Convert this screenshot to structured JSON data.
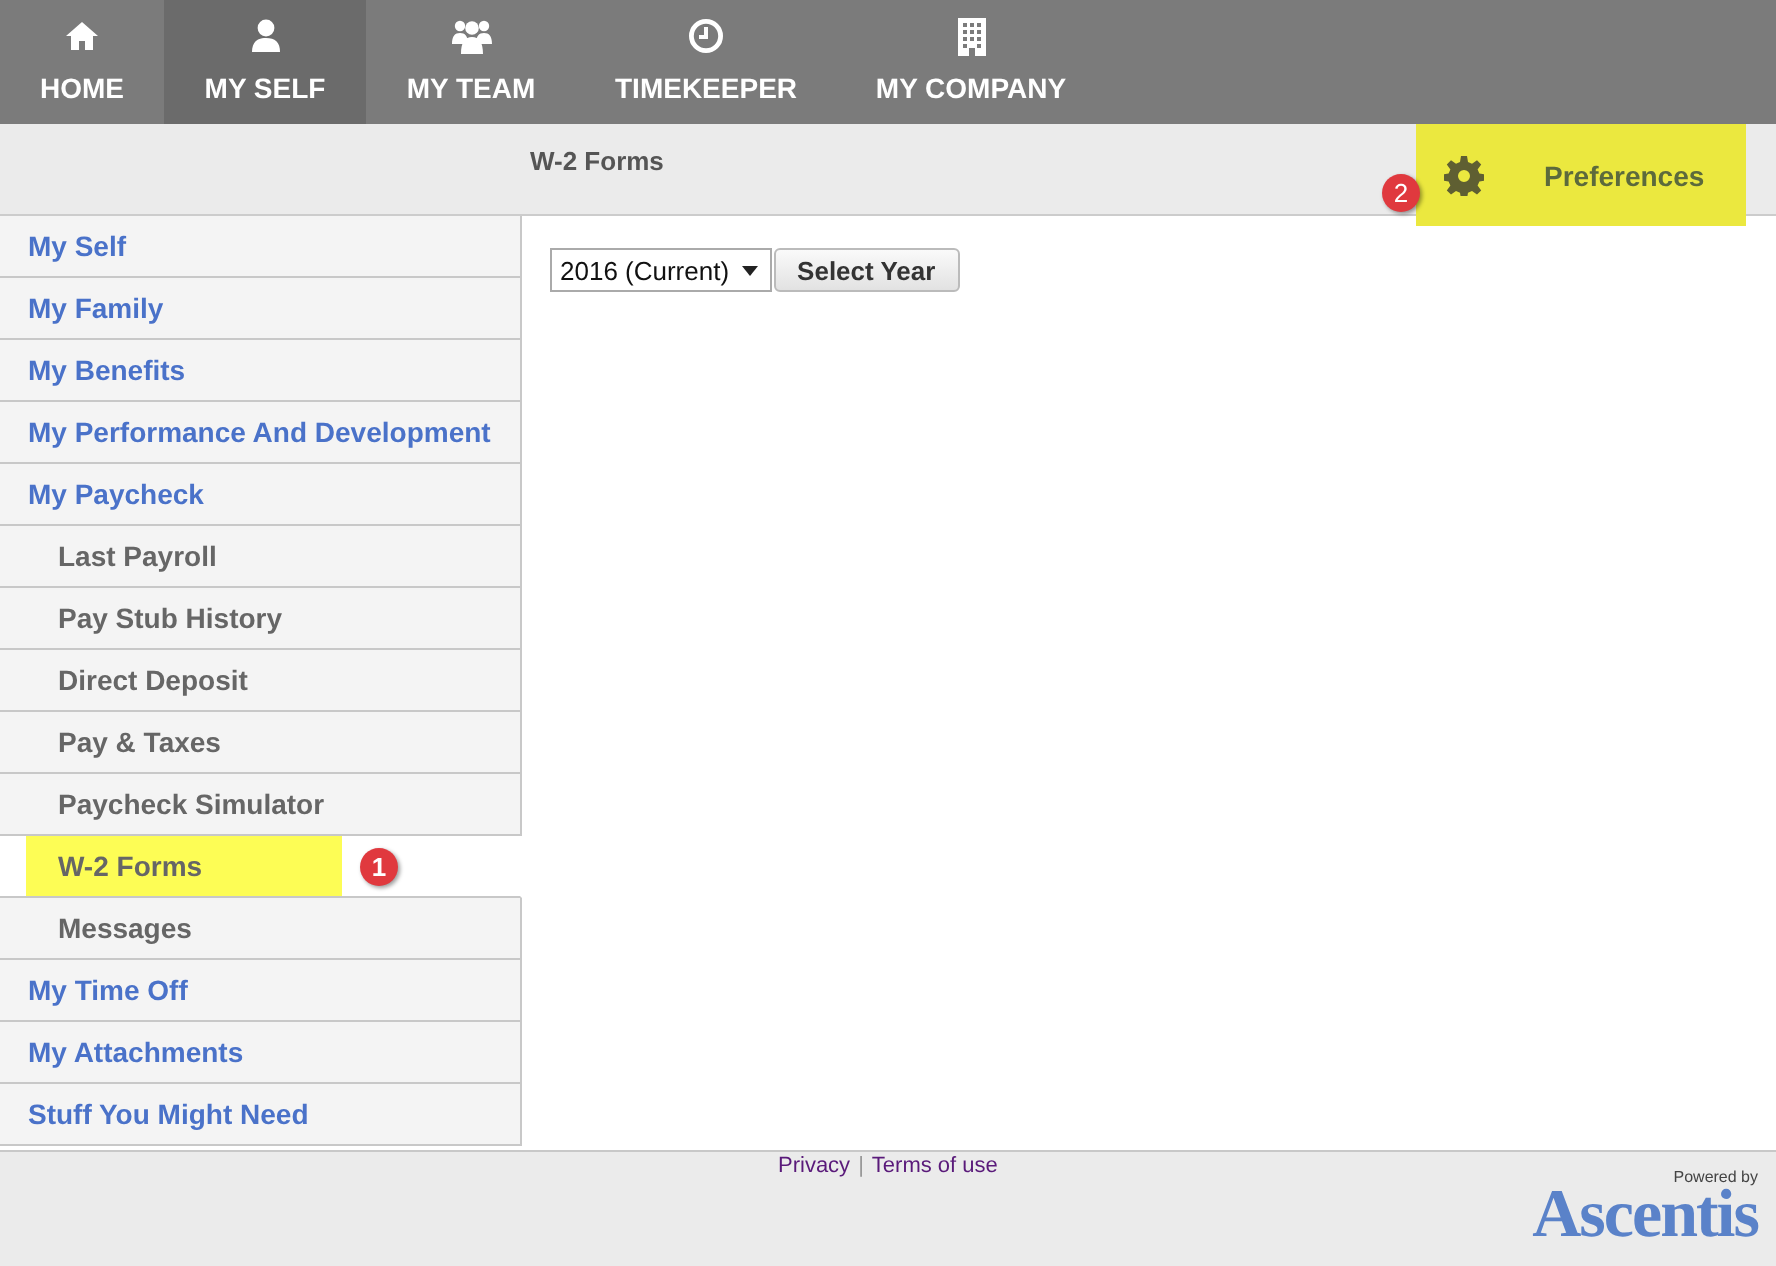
{
  "nav": {
    "tabs": [
      {
        "label": "HOME",
        "kind": "home",
        "selected": false
      },
      {
        "label": "MY SELF",
        "kind": "person",
        "selected": true
      },
      {
        "label": "MY TEAM",
        "kind": "group",
        "selected": false
      },
      {
        "label": "TIMEKEEPER",
        "kind": "clock",
        "selected": false
      },
      {
        "label": "MY COMPANY",
        "kind": "building",
        "selected": false
      }
    ]
  },
  "page_title": "W-2 Forms",
  "preferences": {
    "label": "Preferences",
    "highlighted": true,
    "callout": "2"
  },
  "sidebar": {
    "items": [
      {
        "label": "My Self",
        "selected": false
      },
      {
        "label": "My Family",
        "selected": false
      },
      {
        "label": "My Benefits",
        "selected": false
      },
      {
        "label": "My Performance And Development",
        "selected": false
      },
      {
        "label": "My Paycheck",
        "selected": false,
        "children": [
          {
            "label": "Last Payroll",
            "selected": false
          },
          {
            "label": "Pay Stub History",
            "selected": false
          },
          {
            "label": "Direct Deposit",
            "selected": false
          },
          {
            "label": "Pay & Taxes",
            "selected": false
          },
          {
            "label": "Paycheck Simulator",
            "selected": false
          },
          {
            "label": "W-2 Forms",
            "selected": true,
            "highlighted": true,
            "callout": "1"
          },
          {
            "label": "Messages",
            "selected": false
          }
        ]
      },
      {
        "label": "My Time Off",
        "selected": false
      },
      {
        "label": "My Attachments",
        "selected": false
      },
      {
        "label": "Stuff You Might Need",
        "selected": false
      }
    ]
  },
  "year_select": {
    "value": "2016 (Current)"
  },
  "select_button": "Select Year",
  "footer": {
    "links": [
      "Privacy",
      "Terms of use"
    ],
    "separator": "|",
    "powered_by": "Powered by",
    "brand": "Ascentis"
  }
}
